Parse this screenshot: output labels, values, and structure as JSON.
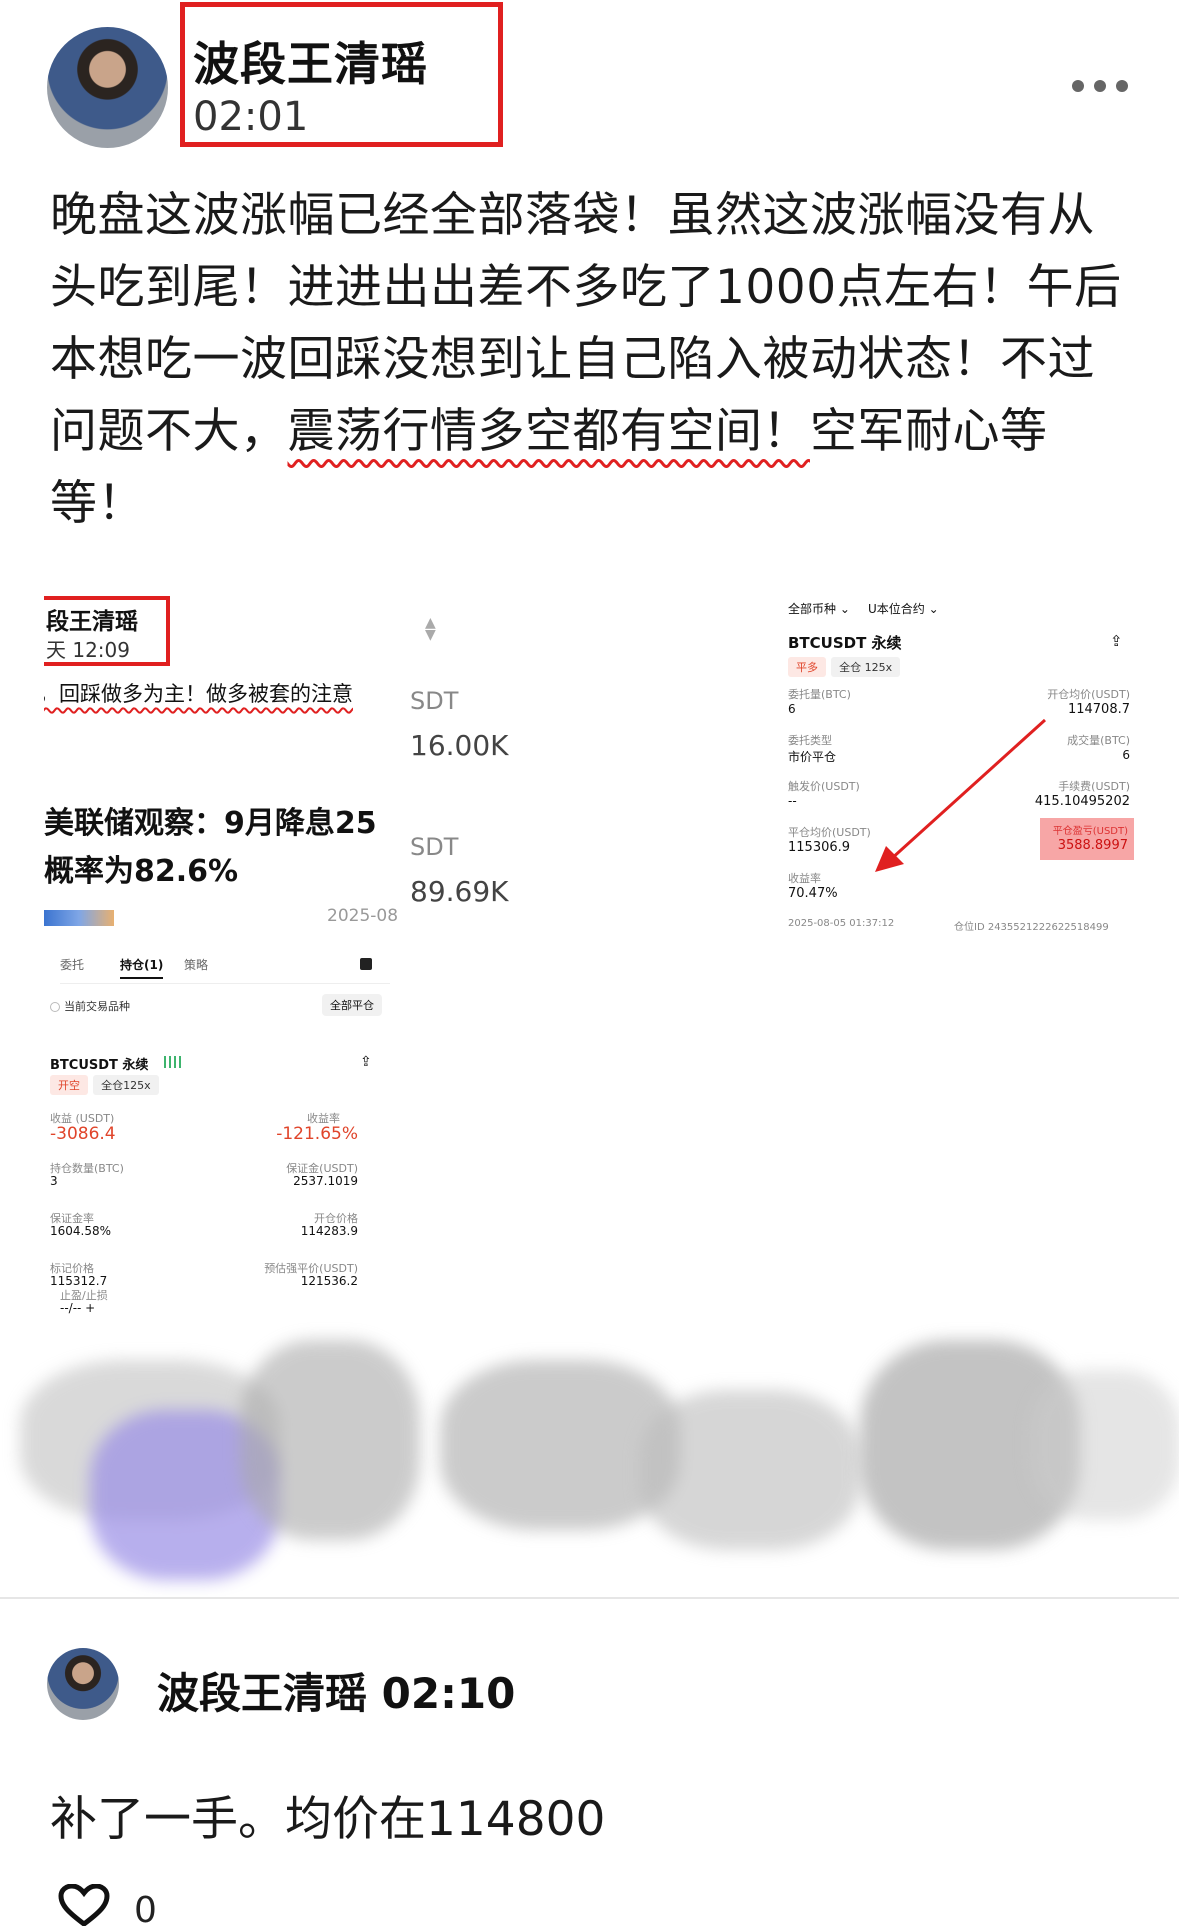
{
  "post": {
    "author": "波段王清瑶",
    "time": "02:01",
    "body_line1": "晚盘这波涨幅已经全部落袋！虽然这波涨幅没有从",
    "body_line2": "头吃到尾！进进出出差不多吃了1000点左右！午后",
    "body_line3": "本想吃一波回踩没想到让自己陷入被动状态！不过",
    "body_line4_a": "问题不大，",
    "body_line4_b": "震荡行情多空都有空间！",
    "body_line4_c": "空军耐心等",
    "body_line5": "等！"
  },
  "left_screenshot": {
    "name": "段王清瑶",
    "time": "天 12:09",
    "line": "，回踩做多为主！做多被套的注意",
    "headline1": "美联储观察：9月降息25",
    "headline2": "概率为82.6%",
    "date": "2025-08",
    "tabs": [
      "委托",
      "持仓(1)",
      "策略"
    ],
    "filter_label": "当前交易品种",
    "close_all": "全部平仓",
    "symbol": "BTCUSDT 永续",
    "tag_side": "开空",
    "tag_lev": "全仓125x",
    "pnl_label": "收益 (USDT)",
    "pnl_value": "-3086.4",
    "roi_label": "收益率",
    "roi_value": "-121.65%",
    "qty_label": "持仓数量(BTC)",
    "qty_value": "3",
    "margin_label": "保证金(USDT)",
    "margin_value": "2537.1019",
    "margin_rate_label": "保证金率",
    "margin_rate_value": "1604.58%",
    "open_price_label": "开仓价格",
    "open_price_value": "114283.9",
    "mark_label": "标记价格",
    "mark_value": "115312.7",
    "liq_label": "预估强平价(USDT)",
    "liq_value": "121536.2",
    "tpsl_label": "止盈/止损",
    "tpsl_value": "--/-- +"
  },
  "mid_screenshot": {
    "sdt1": "SDT",
    "val1": "16.00K",
    "sdt2": "SDT",
    "val2": "89.69K"
  },
  "right_screenshot": {
    "filter1": "全部币种",
    "filter2": "U本位合约",
    "symbol": "BTCUSDT 永续",
    "tag_side": "平多",
    "tag_lev": "全仓 125x",
    "order_qty_label": "委托量(BTC)",
    "order_qty_value": "6",
    "avg_open_label": "开仓均价(USDT)",
    "avg_open_value": "114708.7",
    "order_type_label": "委托类型",
    "order_type_value": "市价平仓",
    "filled_label": "成交量(BTC)",
    "filled_value": "6",
    "trigger_label": "触发价(USDT)",
    "trigger_value": "--",
    "fee_label": "手续费(USDT)",
    "fee_value": "415.10495202",
    "avg_close_label": "平仓均价(USDT)",
    "avg_close_value": "115306.9",
    "pnl_label": "平仓盈亏(USDT)",
    "pnl_value": "3588.8997",
    "roi_label": "收益率",
    "roi_value": "70.47%",
    "time": "2025-08-05 01:37:12",
    "position_id": "仓位ID 2435521222622518499"
  },
  "reply": {
    "author_time": "波段王清瑶 02:10",
    "body": "补了一手。均价在114800",
    "likes": "0"
  }
}
